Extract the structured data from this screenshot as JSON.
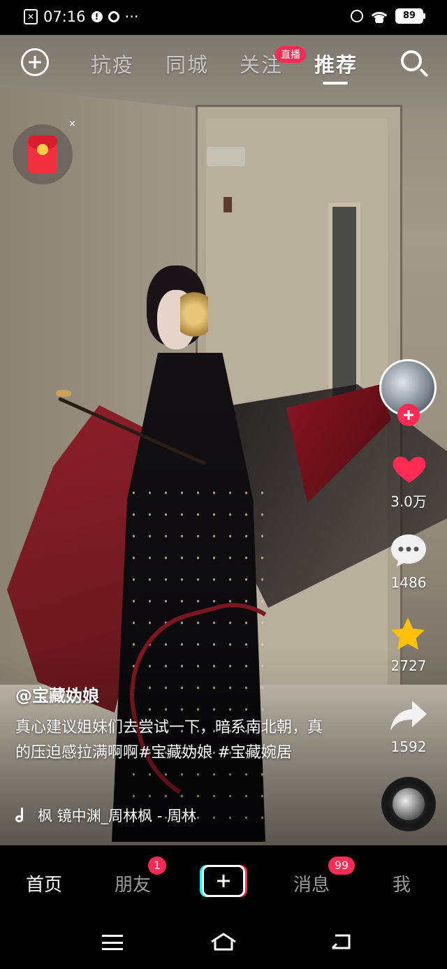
{
  "status_bar": {
    "time": "07:16",
    "icons": [
      "close-box-icon",
      "alert-icon",
      "q-icon",
      "more-icon"
    ],
    "right_icons": [
      "alarm-icon",
      "wifi-icon"
    ],
    "battery": "89",
    "more": "···"
  },
  "top_nav": {
    "tabs": [
      {
        "label": "抗疫",
        "active": false
      },
      {
        "label": "同城",
        "active": false
      },
      {
        "label": "关注",
        "active": false
      },
      {
        "label": "推荐",
        "active": true
      }
    ],
    "live_badge": "直播",
    "icons": [
      "add-circle-icon",
      "search-icon"
    ]
  },
  "floating_widget": {
    "icon": "red-envelope-icon",
    "close": "×"
  },
  "right_rail": {
    "likes": "3.0万",
    "comments": "1486",
    "favorites": "2727",
    "shares": "1592",
    "like_color": "#fe2c55",
    "star_color": "#ffc107"
  },
  "post": {
    "author": "@宝藏妫娘",
    "caption": "真心建议姐妹们去尝试一下，暗系南北朝，真的压迫感拉满啊啊#宝藏妫娘 #宝藏婉居",
    "music": "枫    镜中渊_周林枫 - 周林"
  },
  "bottom_nav": {
    "items": [
      {
        "label": "首页",
        "active": true
      },
      {
        "label": "朋友",
        "badge": "1"
      },
      {
        "label": "消息",
        "badge": "99"
      },
      {
        "label": "我"
      }
    ]
  },
  "accent_colors": {
    "brand_red": "#fe2c55",
    "brand_cyan": "#25f4ee"
  }
}
